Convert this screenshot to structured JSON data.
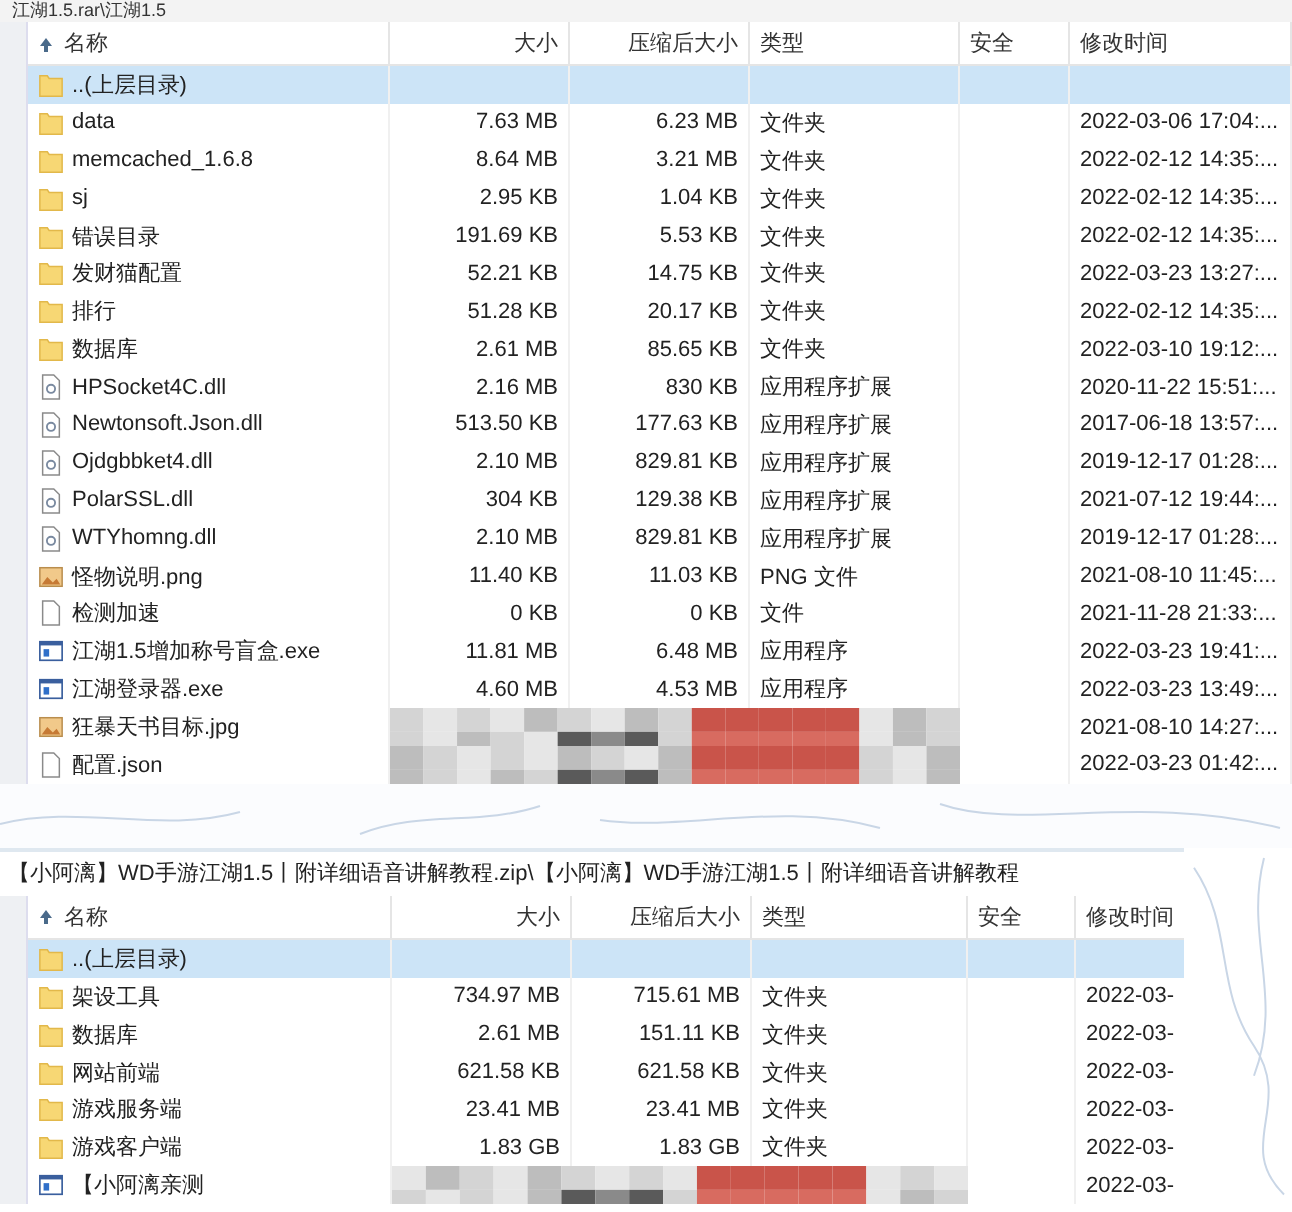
{
  "top_window": {
    "title": "江湖1.5.rar\\江湖1.5",
    "columns": [
      "名称",
      "大小",
      "压缩后大小",
      "类型",
      "安全",
      "修改时间"
    ],
    "rows": [
      {
        "kind": "up",
        "name": "..(上层目录)",
        "selected": true
      },
      {
        "kind": "folder",
        "name": "data",
        "size": "7.63 MB",
        "packed": "6.23 MB",
        "type": "文件夹",
        "time": "2022-03-06 17:04:...",
        "selected": false
      },
      {
        "kind": "folder",
        "name": "memcached_1.6.8",
        "size": "8.64 MB",
        "packed": "3.21 MB",
        "type": "文件夹",
        "time": "2022-02-12 14:35:...",
        "selected": false
      },
      {
        "kind": "folder",
        "name": "sj",
        "size": "2.95 KB",
        "packed": "1.04 KB",
        "type": "文件夹",
        "time": "2022-02-12 14:35:...",
        "selected": false
      },
      {
        "kind": "folder",
        "name": "错误目录",
        "size": "191.69 KB",
        "packed": "5.53 KB",
        "type": "文件夹",
        "time": "2022-02-12 14:35:...",
        "selected": false
      },
      {
        "kind": "folder",
        "name": "发财猫配置",
        "size": "52.21 KB",
        "packed": "14.75 KB",
        "type": "文件夹",
        "time": "2022-03-23 13:27:...",
        "selected": false
      },
      {
        "kind": "folder",
        "name": "排行",
        "size": "51.28 KB",
        "packed": "20.17 KB",
        "type": "文件夹",
        "time": "2022-02-12 14:35:...",
        "selected": false
      },
      {
        "kind": "folder",
        "name": "数据库",
        "size": "2.61 MB",
        "packed": "85.65 KB",
        "type": "文件夹",
        "time": "2022-03-10 19:12:...",
        "selected": false
      },
      {
        "kind": "dll",
        "name": "HPSocket4C.dll",
        "size": "2.16 MB",
        "packed": "830 KB",
        "type": "应用程序扩展",
        "time": "2020-11-22 15:51:...",
        "selected": false
      },
      {
        "kind": "dll",
        "name": "Newtonsoft.Json.dll",
        "size": "513.50 KB",
        "packed": "177.63 KB",
        "type": "应用程序扩展",
        "time": "2017-06-18 13:57:...",
        "selected": false
      },
      {
        "kind": "dll",
        "name": "Ojdgbbket4.dll",
        "size": "2.10 MB",
        "packed": "829.81 KB",
        "type": "应用程序扩展",
        "time": "2019-12-17 01:28:...",
        "selected": false
      },
      {
        "kind": "dll",
        "name": "PolarSSL.dll",
        "size": "304 KB",
        "packed": "129.38 KB",
        "type": "应用程序扩展",
        "time": "2021-07-12 19:44:...",
        "selected": false
      },
      {
        "kind": "dll",
        "name": "WTYhomng.dll",
        "size": "2.10 MB",
        "packed": "829.81 KB",
        "type": "应用程序扩展",
        "time": "2019-12-17 01:28:...",
        "selected": false
      },
      {
        "kind": "image",
        "name": "怪物说明.png",
        "size": "11.40 KB",
        "packed": "11.03 KB",
        "type": "PNG 文件",
        "time": "2021-08-10 11:45:...",
        "selected": false
      },
      {
        "kind": "file",
        "name": "检测加速",
        "size": "0 KB",
        "packed": "0 KB",
        "type": "文件",
        "time": "2021-11-28 21:33:...",
        "selected": false
      },
      {
        "kind": "exe",
        "name": "江湖1.5增加称号盲盒.exe",
        "size": "11.81 MB",
        "packed": "6.48 MB",
        "type": "应用程序",
        "time": "2022-03-23 19:41:...",
        "selected": false
      },
      {
        "kind": "exe",
        "name": "江湖登录器.exe",
        "size": "4.60 MB",
        "packed": "4.53 MB",
        "type": "应用程序",
        "time": "2022-03-23 13:49:...",
        "selected": false
      },
      {
        "kind": "image",
        "name": "狂暴天书目标.jpg",
        "time": "2021-08-10 14:27:...",
        "selected": false,
        "redacted": true
      },
      {
        "kind": "file",
        "name": "配置.json",
        "time": "2022-03-23 01:42:...",
        "selected": false,
        "redacted": true
      }
    ]
  },
  "bottom_window": {
    "title": "【小阿漓】WD手游江湖1.5丨附详细语音讲解教程.zip\\【小阿漓】WD手游江湖1.5丨附详细语音讲解教程",
    "columns": [
      "名称",
      "大小",
      "压缩后大小",
      "类型",
      "安全",
      "修改时间"
    ],
    "rows": [
      {
        "kind": "up",
        "name": "..(上层目录)",
        "selected": true
      },
      {
        "kind": "folder",
        "name": "架设工具",
        "size": "734.97 MB",
        "packed": "715.61 MB",
        "type": "文件夹",
        "time": "2022-03-",
        "selected": false
      },
      {
        "kind": "folder",
        "name": "数据库",
        "size": "2.61 MB",
        "packed": "151.11 KB",
        "type": "文件夹",
        "time": "2022-03-",
        "selected": false
      },
      {
        "kind": "folder",
        "name": "网站前端",
        "size": "621.58 KB",
        "packed": "621.58 KB",
        "type": "文件夹",
        "time": "2022-03-",
        "selected": false
      },
      {
        "kind": "folder",
        "name": "游戏服务端",
        "size": "23.41 MB",
        "packed": "23.41 MB",
        "type": "文件夹",
        "time": "2022-03-",
        "selected": false
      },
      {
        "kind": "folder",
        "name": "游戏客户端",
        "size": "1.83 GB",
        "packed": "1.83 GB",
        "type": "文件夹",
        "time": "2022-03-",
        "selected": false
      },
      {
        "kind": "exe",
        "name": "【小阿漓亲测",
        "time": "2022-03-",
        "selected": false,
        "redacted": true
      }
    ]
  }
}
